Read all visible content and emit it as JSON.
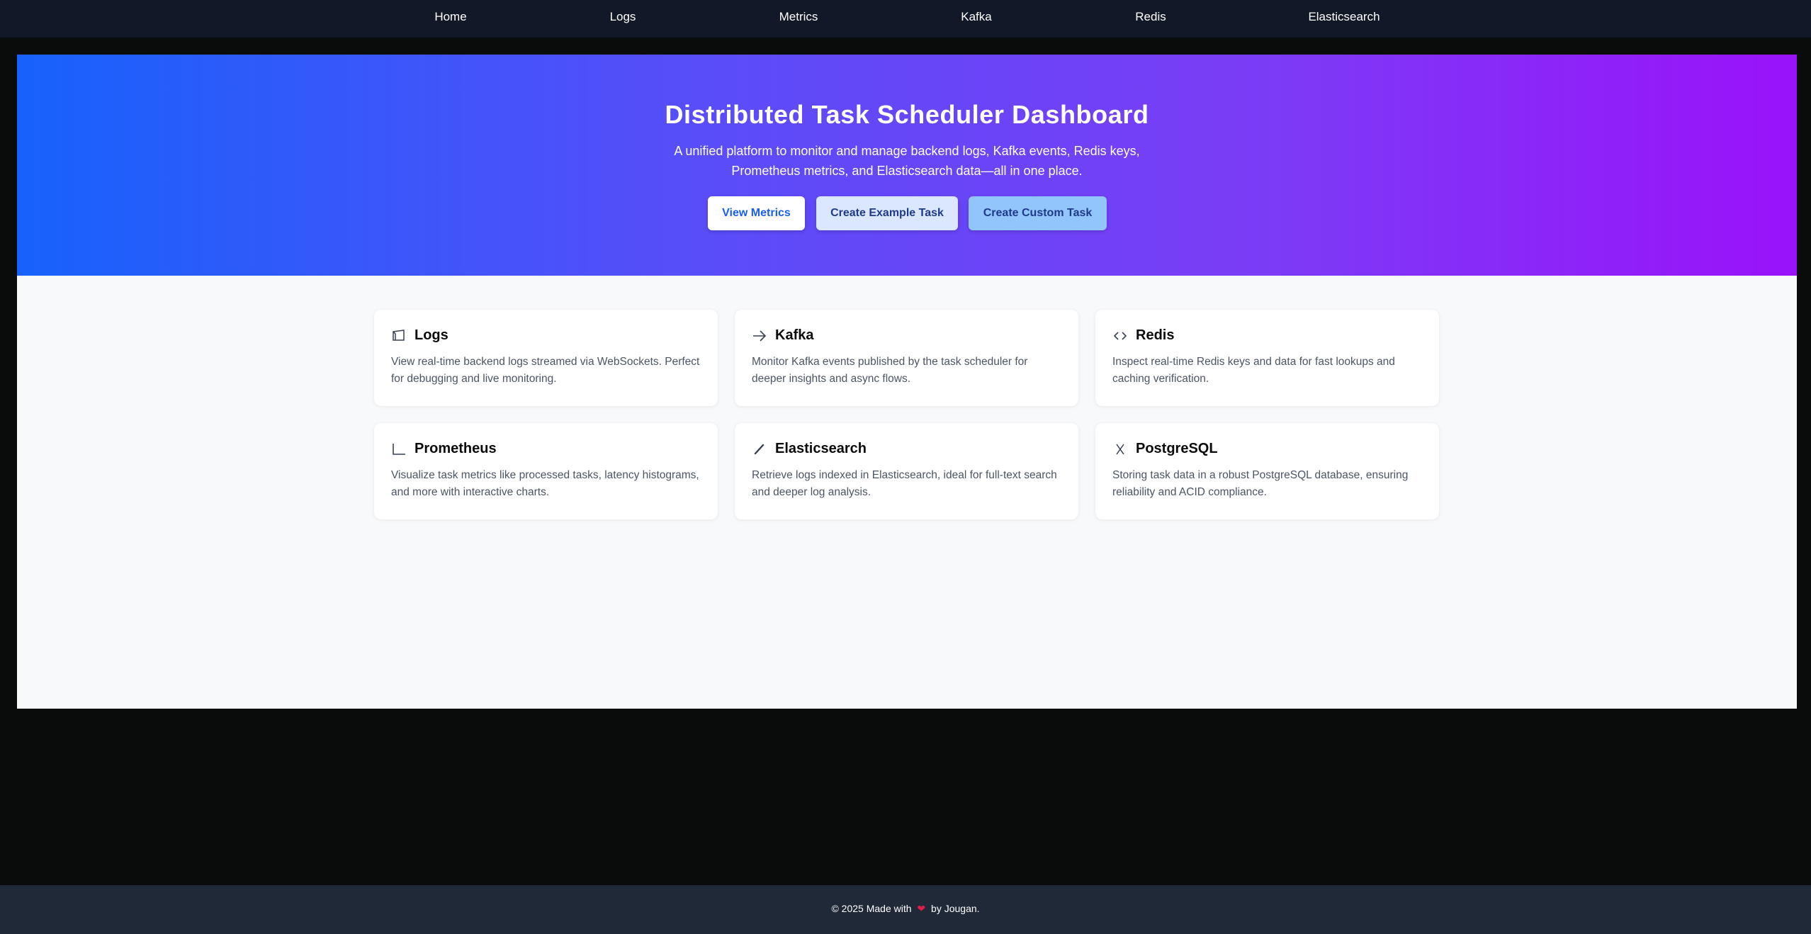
{
  "nav": {
    "items": [
      "Home",
      "Logs",
      "Metrics",
      "Kafka",
      "Redis",
      "Elasticsearch"
    ]
  },
  "hero": {
    "title": "Distributed Task Scheduler Dashboard",
    "subtitle": "A unified platform to monitor and manage backend logs, Kafka events, Redis keys, Prometheus metrics, and Elasticsearch data—all in one place.",
    "buttons": {
      "view_metrics": "View Metrics",
      "create_example": "Create Example Task",
      "create_custom": "Create Custom Task"
    }
  },
  "cards": [
    {
      "icon": "folder-icon",
      "title": "Logs",
      "description": "View real-time backend logs streamed via WebSockets. Perfect for debugging and live monitoring."
    },
    {
      "icon": "arrow-right-icon",
      "title": "Kafka",
      "description": "Monitor Kafka events published by the task scheduler for deeper insights and async flows."
    },
    {
      "icon": "code-icon",
      "title": "Redis",
      "description": "Inspect real-time Redis keys and data for fast lookups and caching verification."
    },
    {
      "icon": "chart-axis-icon",
      "title": "Prometheus",
      "description": "Visualize task metrics like processed tasks, latency histograms, and more with interactive charts."
    },
    {
      "icon": "pen-icon",
      "title": "Elasticsearch",
      "description": "Retrieve logs indexed in Elasticsearch, ideal for full-text search and deeper log analysis."
    },
    {
      "icon": "x-icon",
      "title": "PostgreSQL",
      "description": "Storing task data in a robust PostgreSQL database, ensuring reliability and ACID compliance."
    }
  ],
  "footer": {
    "prefix": "© 2025 Made with",
    "suffix": "by Jougan."
  },
  "colors": {
    "nav_bg": "#111827",
    "page_bg": "#0a0b0b",
    "hero_gradient_start": "#1762fb",
    "hero_gradient_end": "#9a12fa",
    "footer_bg": "#1f2937",
    "heart": "#e11d48"
  }
}
